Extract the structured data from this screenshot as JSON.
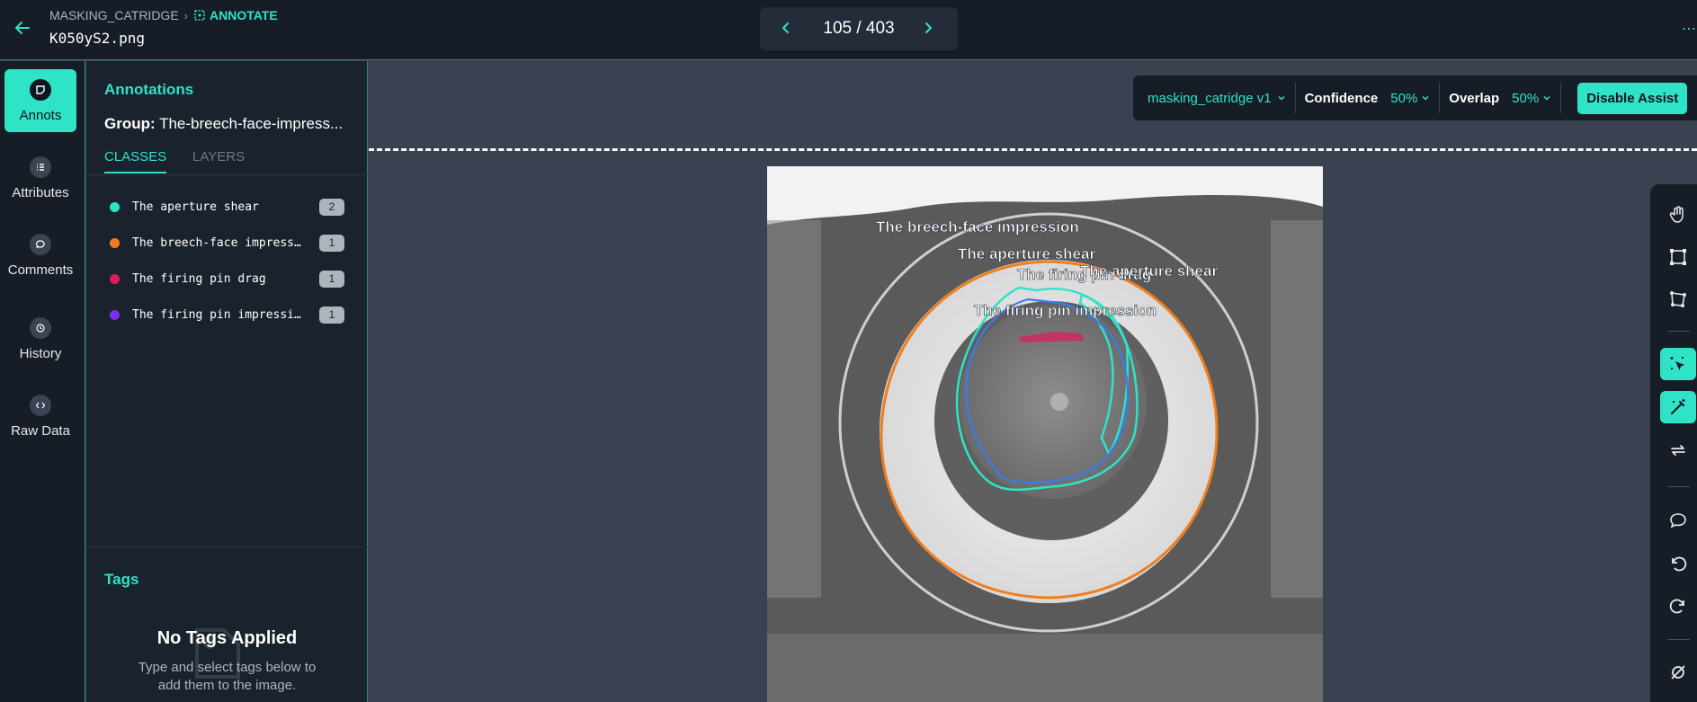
{
  "header": {
    "breadcrumb_project": "MASKING_CATRIDGE",
    "breadcrumb_mode": "ANNOTATE",
    "filename": "K050yS2.png",
    "pager": "105 / 403"
  },
  "rail": {
    "items": [
      {
        "label": "Annots",
        "icon": "annotation-icon"
      },
      {
        "label": "Attributes",
        "icon": "list-icon"
      },
      {
        "label": "Comments",
        "icon": "chat-bubble-icon"
      },
      {
        "label": "History",
        "icon": "history-icon"
      },
      {
        "label": "Raw Data",
        "icon": "code-icon"
      }
    ]
  },
  "panel": {
    "title": "Annotations",
    "group_label": "Group:",
    "group_value": "The-breech-face-impress...",
    "tabs": [
      "CLASSES",
      "LAYERS"
    ],
    "classes": [
      {
        "name": "The aperture shear",
        "count": "2",
        "color": "#2fe3c6"
      },
      {
        "name": "The breech-face impress…",
        "count": "1",
        "color": "#f07e1e"
      },
      {
        "name": "The firing pin drag",
        "count": "1",
        "color": "#e0195a"
      },
      {
        "name": "The firing pin impressi…",
        "count": "1",
        "color": "#7b2ff0"
      }
    ],
    "tags_title": "Tags",
    "tags_empty_title": "No Tags Applied",
    "tags_empty_sub": "Type and select tags below to add them to the image."
  },
  "assist": {
    "model": "masking_catridge v1",
    "confidence_label": "Confidence",
    "confidence_value": "50%",
    "overlap_label": "Overlap",
    "overlap_value": "50%",
    "disable_label": "Disable Assist"
  },
  "image_labels": {
    "breech": "The breech-face impression",
    "aperture1": "The aperture shear",
    "firing_drag": "The firing pin drag",
    "aperture2": "The aperture shear",
    "firing_impression": "The firing pin impression"
  },
  "toolbar": {
    "tools": [
      "hand-icon",
      "bounding-box-icon",
      "polygon-icon",
      "smart-select-icon",
      "magic-wand-icon",
      "swap-icon",
      "comment-icon",
      "undo-icon",
      "redo-icon",
      "hide-icon"
    ]
  },
  "colors": {
    "accent": "#2fe3c6",
    "aperture": "#2fe3c6",
    "breech": "#f07e1e",
    "drag": "#e0195a",
    "impression": "#7b2ff0"
  }
}
